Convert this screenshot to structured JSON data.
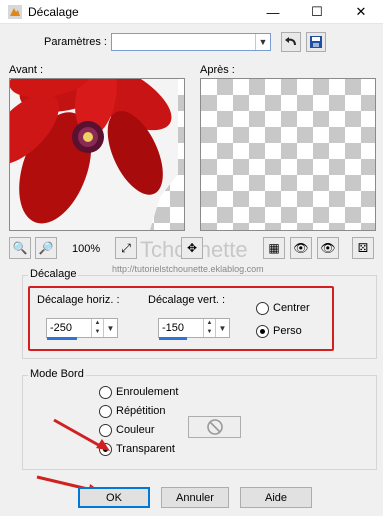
{
  "window": {
    "title": "Décalage",
    "minimize": "—",
    "maximize": "☐",
    "close": "✕"
  },
  "params": {
    "label": "Paramètres :",
    "value": ""
  },
  "previews": {
    "before_label": "Avant :",
    "after_label": "Après :"
  },
  "zoom": {
    "value": "100%"
  },
  "watermark": {
    "title": "Tchounette",
    "url": "http://tutorielstchounette.eklablog.com"
  },
  "offset": {
    "group_title": "Décalage",
    "horiz_label": "Décalage horiz. :",
    "horiz_value": "-250",
    "vert_label": "Décalage vert. :",
    "vert_value": "-150",
    "center_label": "Centrer",
    "custom_label": "Perso",
    "selected": "Perso"
  },
  "edge_mode": {
    "group_title": "Mode Bord",
    "options": [
      "Enroulement",
      "Répétition",
      "Couleur",
      "Transparent"
    ],
    "selected": "Transparent"
  },
  "buttons": {
    "ok": "OK",
    "cancel": "Annuler",
    "help": "Aide"
  },
  "colors": {
    "annotation_red": "#d21f1f",
    "accent_blue": "#0078d7"
  }
}
